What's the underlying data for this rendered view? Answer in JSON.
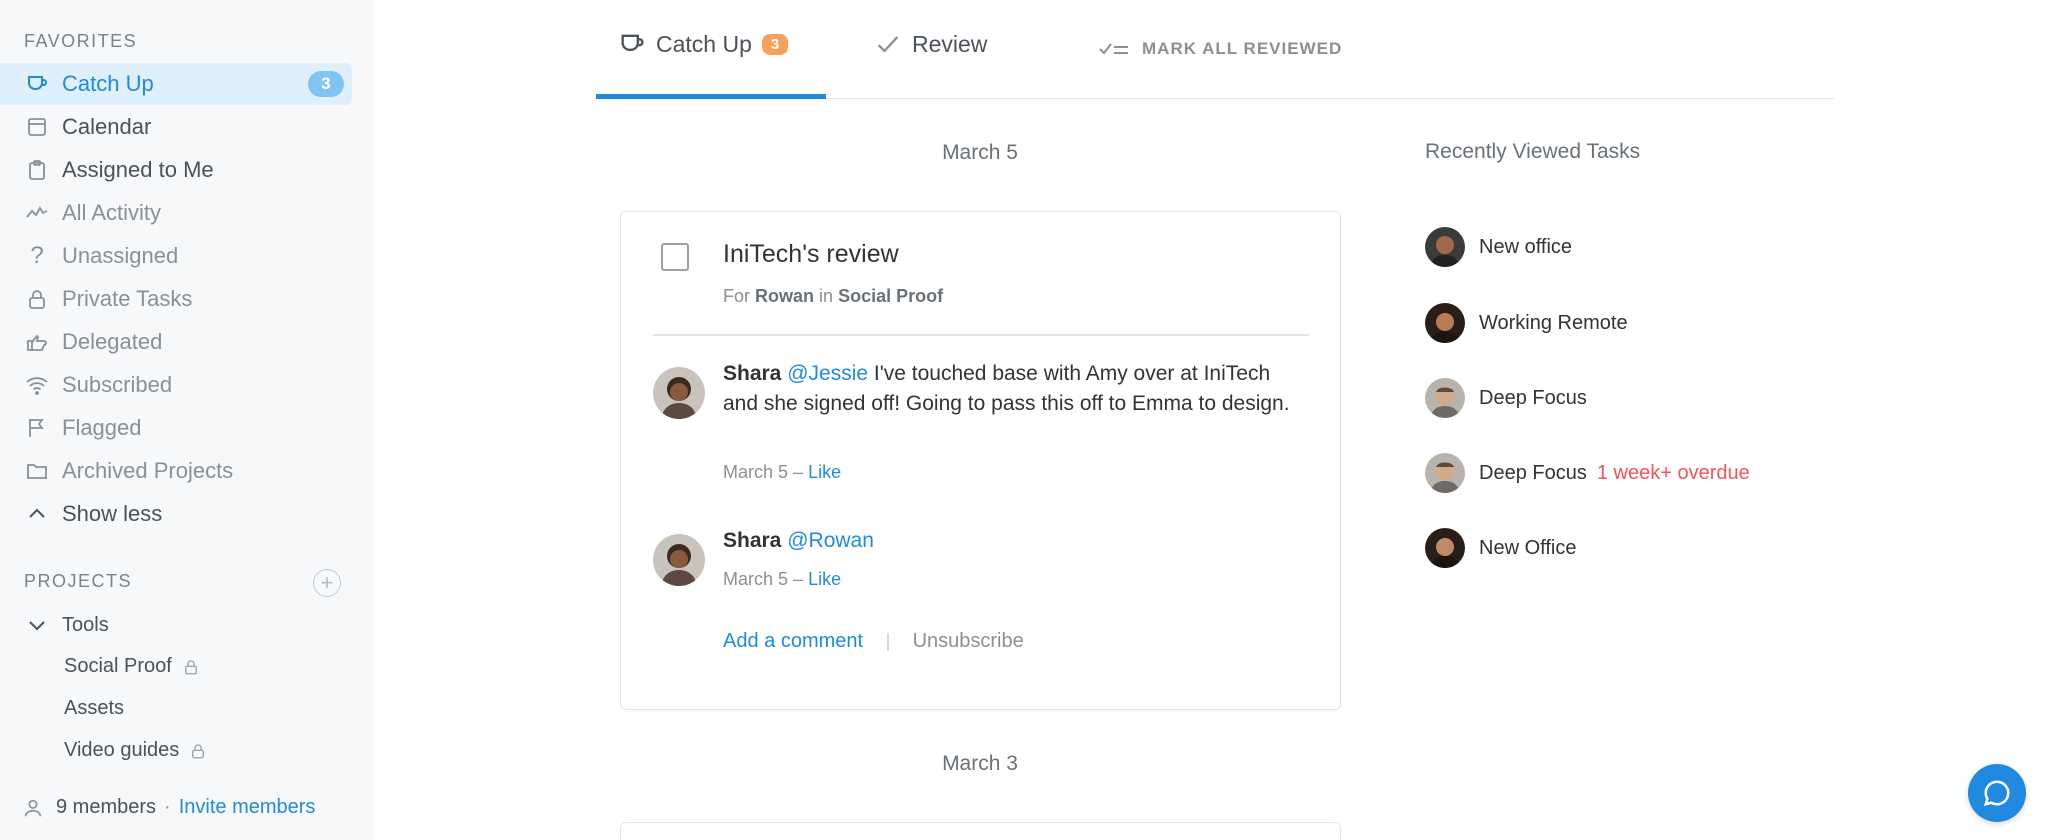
{
  "sidebar": {
    "favorites_label": "FAVORITES",
    "items": [
      {
        "label": "Catch Up",
        "icon": "mug-icon",
        "badge": "3"
      },
      {
        "label": "Calendar",
        "icon": "calendar-icon"
      },
      {
        "label": "Assigned to Me",
        "icon": "clipboard-icon"
      },
      {
        "label": "All Activity",
        "icon": "activity-icon"
      },
      {
        "label": "Unassigned",
        "icon": "question-icon"
      },
      {
        "label": "Private Tasks",
        "icon": "lock-icon"
      },
      {
        "label": "Delegated",
        "icon": "delegate-hand-icon"
      },
      {
        "label": "Subscribed",
        "icon": "wifi-icon"
      },
      {
        "label": "Flagged",
        "icon": "flag-icon"
      },
      {
        "label": "Archived Projects",
        "icon": "folder-icon"
      },
      {
        "label": "Show less",
        "icon": "chevron-up-icon"
      }
    ],
    "projects_label": "PROJECTS",
    "projects_group": "Tools",
    "projects": [
      {
        "label": "Social Proof",
        "locked": true
      },
      {
        "label": "Assets",
        "locked": false
      },
      {
        "label": "Video guides",
        "locked": true
      }
    ],
    "members_count": "9 members",
    "members_sep": "·",
    "invite_label": "Invite members"
  },
  "tabs": {
    "catch_up_label": "Catch Up",
    "catch_up_badge": "3",
    "review_label": "Review",
    "mark_all_label": "MARK ALL REVIEWED"
  },
  "feed": {
    "date1": "March 5",
    "date2": "March 3",
    "task": {
      "title": "IniTech's review",
      "for_word": "For",
      "assignee": "Rowan",
      "in_word": "in",
      "project": "Social Proof"
    },
    "comments": [
      {
        "author": "Shara",
        "mention": "@Jessie",
        "text": " I've touched base with Amy over at IniTech and she signed off! Going to pass this off to Emma to design.",
        "date": "March 5 –",
        "like": "Like"
      },
      {
        "author": "Shara",
        "mention": "@Rowan",
        "text": "",
        "date": "March 5 –",
        "like": "Like"
      }
    ],
    "add_comment": "Add a comment",
    "unsubscribe": "Unsubscribe"
  },
  "recent": {
    "title": "Recently Viewed Tasks",
    "items": [
      {
        "label": "New office",
        "overdue": ""
      },
      {
        "label": "Working Remote",
        "overdue": ""
      },
      {
        "label": "Deep Focus",
        "overdue": ""
      },
      {
        "label": "Deep Focus",
        "overdue": "1 week+ overdue"
      },
      {
        "label": "New Office",
        "overdue": ""
      }
    ]
  },
  "colors": {
    "accent": "#1f8ae0",
    "badge_orange": "#f7a05c",
    "overdue": "#f2545b"
  }
}
